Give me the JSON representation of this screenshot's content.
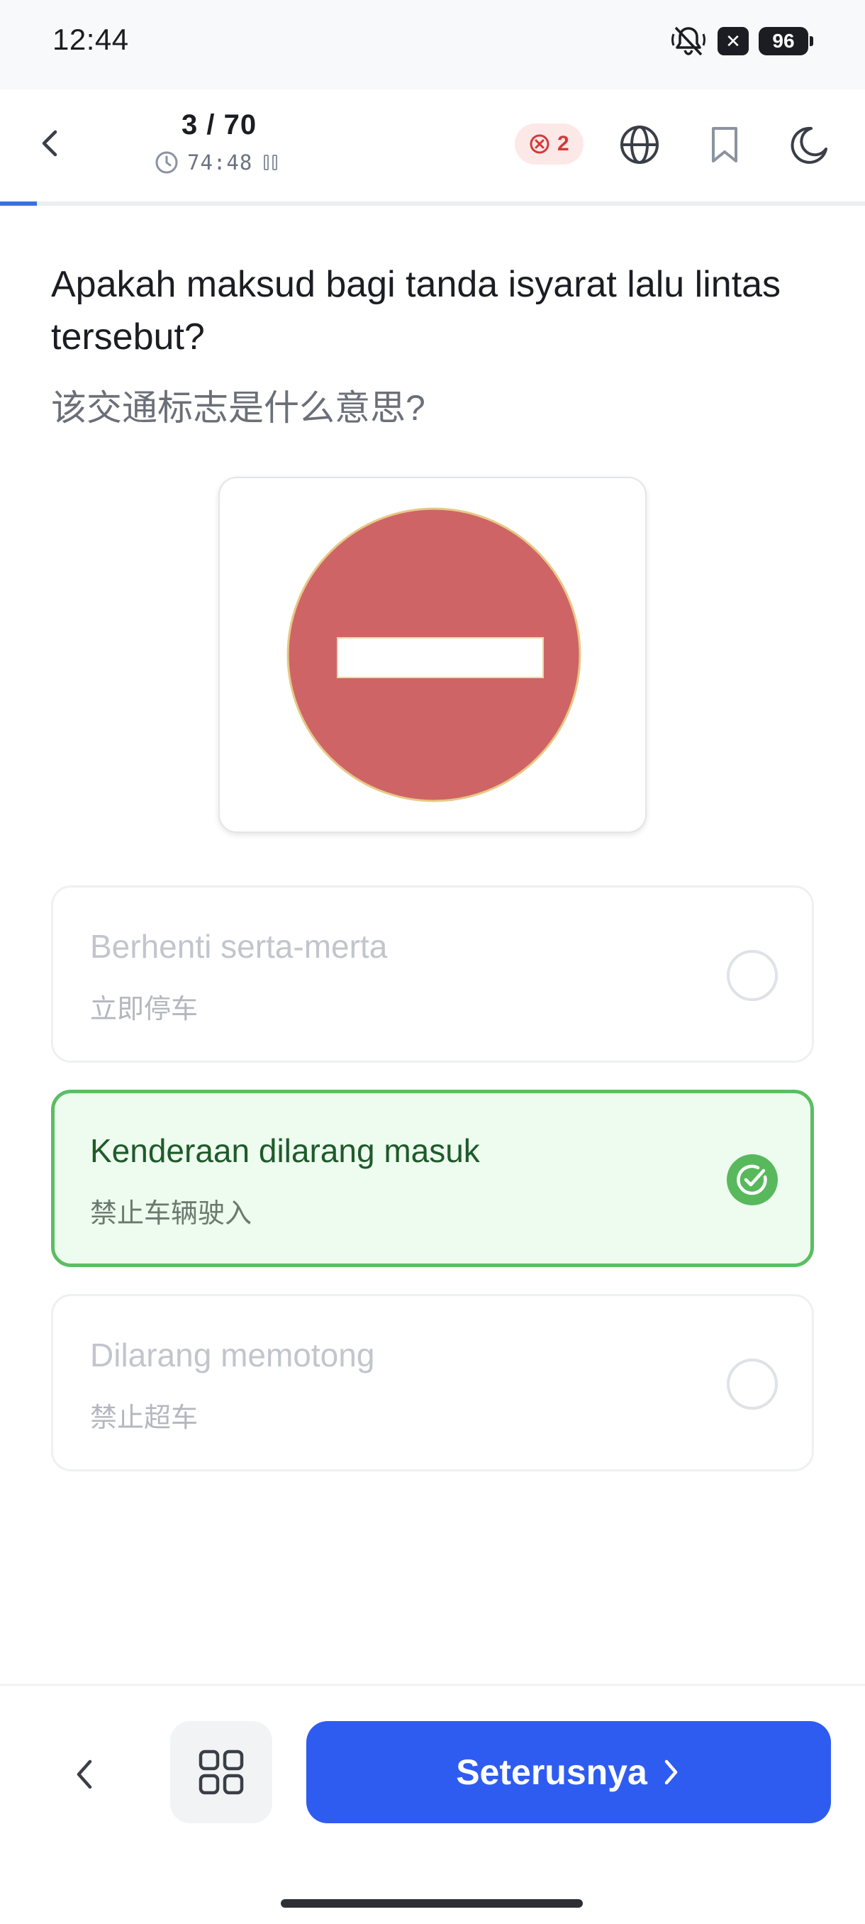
{
  "status_bar": {
    "time": "12:44",
    "icons": [
      "bell-off-icon",
      "close-notification-icon",
      "battery-icon"
    ],
    "battery_level": "96",
    "notification_glyph": "✕"
  },
  "header": {
    "question_counter": "3 / 70",
    "current_question": 3,
    "total_questions": 70,
    "timer": "74:48",
    "wrong_count": "2",
    "progress_fraction": 0.043,
    "icons": [
      "back-arrow-icon",
      "clock-icon",
      "pause-icon",
      "wrong-x-icon",
      "globe-icon",
      "bookmark-icon",
      "moon-icon"
    ]
  },
  "question": {
    "text_ms": "Apakah maksud bagi tanda isyarat lalu lintas tersebut?",
    "text_zh": "该交通标志是什么意思?",
    "image": "no-entry-sign"
  },
  "options": [
    {
      "label_ms": "Berhenti serta-merta",
      "label_zh": "立即停车",
      "selected": false
    },
    {
      "label_ms": "Kenderaan dilarang masuk",
      "label_zh": "禁止车辆驶入",
      "selected": true
    },
    {
      "label_ms": "Dilarang memotong",
      "label_zh": "禁止超车",
      "selected": false
    }
  ],
  "bottom_bar": {
    "next_label": "Seterusnya",
    "icons": [
      "chevron-left-icon",
      "grid-icon",
      "chevron-right-icon"
    ]
  },
  "colors": {
    "accent_blue": "#2f5cf0",
    "progress_blue": "#3b6fe0",
    "correct_green": "#5cbd62",
    "correct_bg": "#eefbef",
    "wrong_red": "#d23a3a",
    "sign_red": "#cf6466"
  }
}
